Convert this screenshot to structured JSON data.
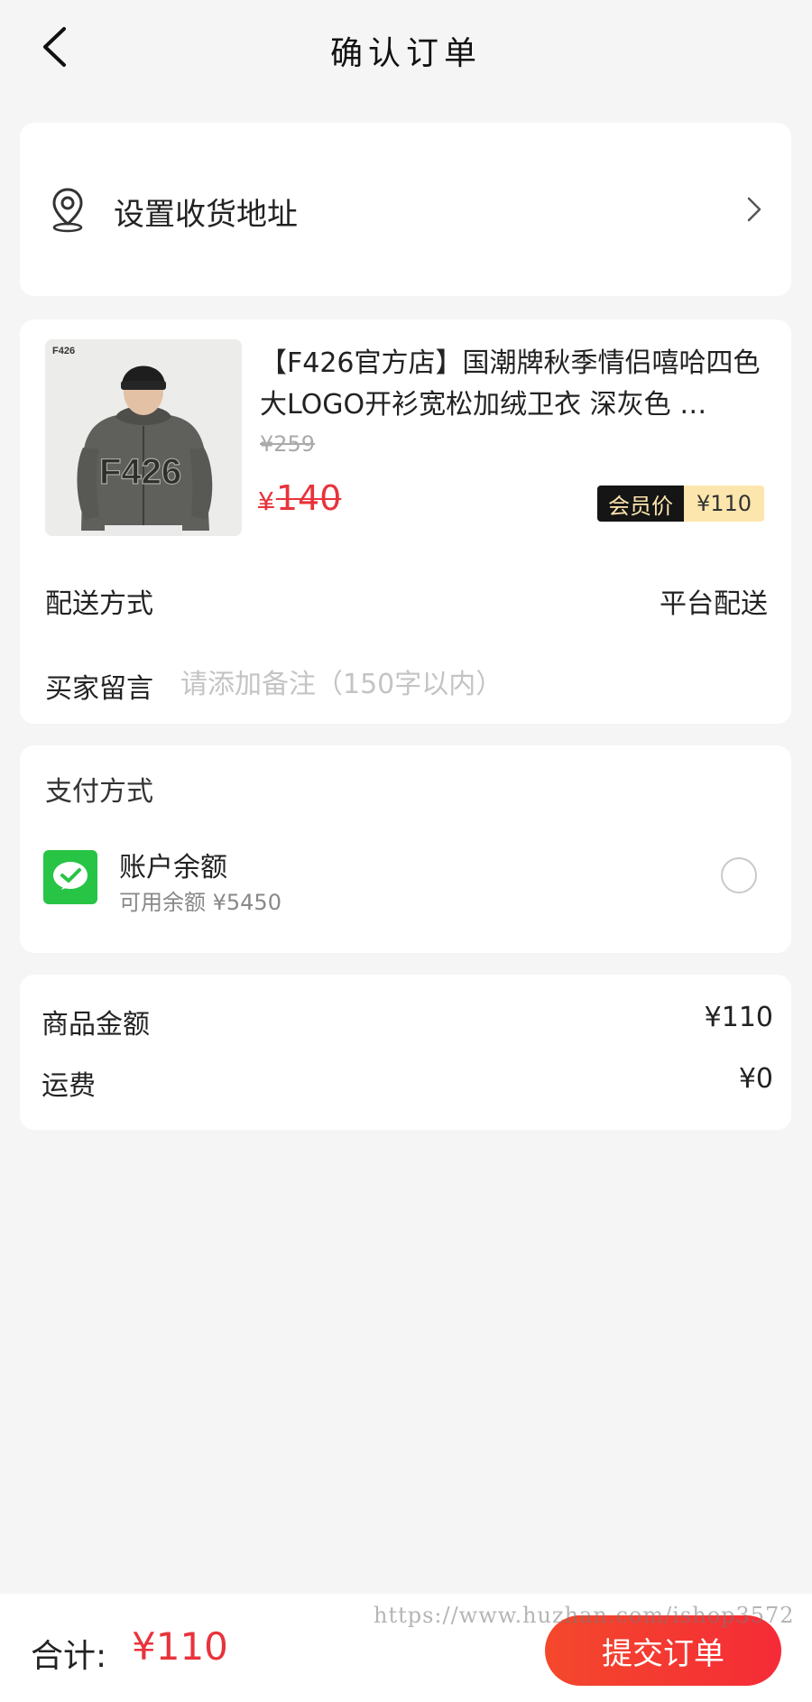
{
  "header": {
    "title": "确认订单"
  },
  "address": {
    "label": "设置收货地址"
  },
  "product": {
    "brand_tag": "F426",
    "title": "【F426官方店】国潮牌秋季情侣嘻哈四色大LOGO开衫宽松加绒卫衣 深灰色 …",
    "original_price": "¥259",
    "price_symbol": "¥",
    "price": "140",
    "member_label": "会员价",
    "member_price": "¥110",
    "print_text": "F426"
  },
  "delivery": {
    "label": "配送方式",
    "value": "平台配送"
  },
  "remark": {
    "label": "买家留言",
    "placeholder": "请添加备注（150字以内）"
  },
  "payment": {
    "title": "支付方式",
    "method_name": "账户余额",
    "balance": "可用余额 ¥5450"
  },
  "summary": {
    "goods_label": "商品金额",
    "goods_value": "¥110",
    "shipping_label": "运费",
    "shipping_value": "¥0"
  },
  "footer": {
    "total_label": "合计:",
    "total_value": "¥110",
    "submit_label": "提交订单"
  },
  "watermark": "https://www.huzhan.com/ishop3572",
  "colors": {
    "accent_red": "#e8333b",
    "pay_green": "#28c445",
    "member_gold": "#fde6ad"
  }
}
